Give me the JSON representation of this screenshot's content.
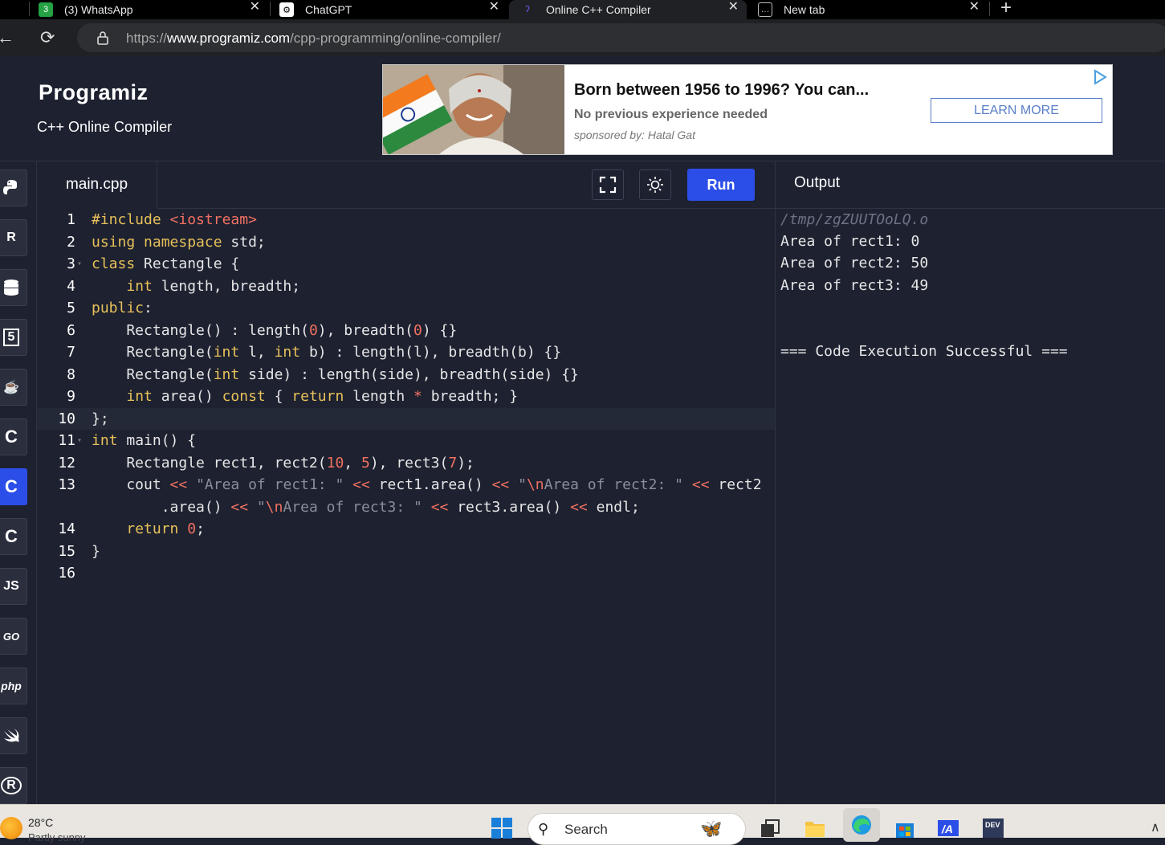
{
  "browser": {
    "tabs": [
      {
        "badge": "3",
        "label": "(3) WhatsApp",
        "icon": "whatsapp-icon"
      },
      {
        "label": "ChatGPT",
        "icon": "chatgpt-icon"
      },
      {
        "label": "Online C++ Compiler",
        "icon": "programiz-icon"
      },
      {
        "label": "New tab",
        "icon": "newtab-icon"
      }
    ],
    "url_domain": "www.programiz.com",
    "url_prefix": "https://",
    "url_path": "/cpp-programming/online-compiler/"
  },
  "site": {
    "logo": "Programiz",
    "subtitle": "C++ Online Compiler"
  },
  "ad": {
    "headline": "Born between 1956 to 1996? You can...",
    "subline": "No previous experience needed",
    "sponsor": "sponsored by: Hatal Gat",
    "button": "LEARN MORE"
  },
  "sidebar": {
    "languages": [
      {
        "name": "python-icon",
        "glyph": "",
        "active": false
      },
      {
        "name": "r-icon",
        "glyph": "R",
        "active": false
      },
      {
        "name": "sql-icon",
        "glyph": "",
        "active": false
      },
      {
        "name": "html-icon",
        "glyph": "5",
        "active": false
      },
      {
        "name": "java-icon",
        "glyph": "",
        "active": false
      },
      {
        "name": "c-icon",
        "glyph": "C",
        "active": false
      },
      {
        "name": "cpp-icon",
        "glyph": "C",
        "active": true
      },
      {
        "name": "csharp-icon",
        "glyph": "C",
        "active": false
      },
      {
        "name": "js-icon",
        "glyph": "JS",
        "active": false
      },
      {
        "name": "go-icon",
        "glyph": "GO",
        "active": false
      },
      {
        "name": "php-icon",
        "glyph": "php",
        "active": false
      },
      {
        "name": "swift-icon",
        "glyph": "",
        "active": false
      },
      {
        "name": "rust-icon",
        "glyph": "R",
        "active": false
      }
    ]
  },
  "editor": {
    "filename": "main.cpp",
    "run_label": "Run",
    "lines": [
      {
        "n": "1",
        "html": "<span class='k'>#include</span> <span class='inc'>&lt;iostream&gt;</span>"
      },
      {
        "n": "2",
        "html": "<span class='k'>using namespace</span> std;"
      },
      {
        "n": "3",
        "fold": true,
        "html": "<span class='k'>class</span> Rectangle {"
      },
      {
        "n": "4",
        "html": "    <span class='k'>int</span> length, breadth;"
      },
      {
        "n": "5",
        "html": "<span class='k'>public</span>:"
      },
      {
        "n": "6",
        "html": "    Rectangle() : length(<span class='n'>0</span>), breadth(<span class='n'>0</span>) {}"
      },
      {
        "n": "7",
        "html": "    Rectangle(<span class='k'>int</span> l, <span class='k'>int</span> b) : length(l), breadth(b) {}"
      },
      {
        "n": "8",
        "html": "    Rectangle(<span class='k'>int</span> side) : length(side), breadth(side) {}"
      },
      {
        "n": "9",
        "html": "    <span class='k'>int</span> area() <span class='k'>const</span> { <span class='kr'>return</span> length <span class='n'>*</span> breadth; }"
      },
      {
        "n": "10",
        "hl": true,
        "html": "};"
      },
      {
        "n": "11",
        "fold": true,
        "html": "<span class='k'>int</span> main() {"
      },
      {
        "n": "12",
        "html": "    Rectangle rect1, rect2(<span class='n'>10</span>, <span class='n'>5</span>), rect3(<span class='n'>7</span>);"
      },
      {
        "n": "13",
        "html": "    cout <span class='n'>&lt;&lt;</span> <span class='s'>\"Area of rect1: \"</span> <span class='n'>&lt;&lt;</span> rect1.area() <span class='n'>&lt;&lt;</span> <span class='s'>\"<span class='esc'>\\n</span>Area of rect2: \"</span> <span class='n'>&lt;&lt;</span> rect2"
      },
      {
        "n": "",
        "html": "        .area() <span class='n'>&lt;&lt;</span> <span class='s'>\"<span class='esc'>\\n</span>Area of rect3: \"</span> <span class='n'>&lt;&lt;</span> rect3.area() <span class='n'>&lt;&lt;</span> endl;"
      },
      {
        "n": "14",
        "html": "    <span class='kr'>return</span> <span class='n'>0</span>;"
      },
      {
        "n": "15",
        "html": "}"
      },
      {
        "n": "16",
        "html": ""
      }
    ]
  },
  "output": {
    "title": "Output",
    "path": "/tmp/zgZUUTOoLQ.o",
    "lines": [
      "Area of rect1: 0",
      "Area of rect2: 50",
      "Area of rect3: 49"
    ],
    "status": "=== Code Execution Successful ==="
  },
  "taskbar": {
    "temp": "28°C",
    "weather": "Partly sunny",
    "search": "Search"
  }
}
